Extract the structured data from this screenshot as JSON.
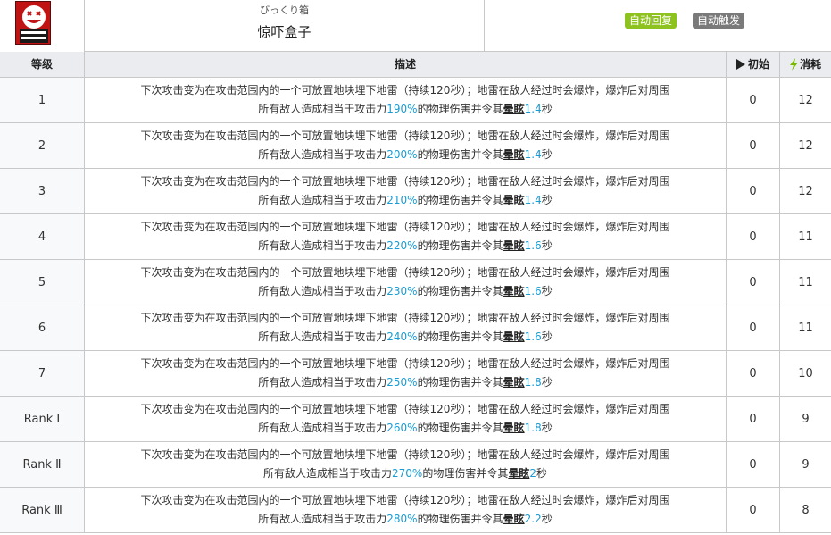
{
  "skill": {
    "ruby": "びっくり箱",
    "name": "惊吓盒子",
    "tags": [
      "自动回复",
      "自动触发"
    ],
    "icon": "surprise-box-skill-icon"
  },
  "table": {
    "headers": {
      "level": "等级",
      "desc": "描述",
      "init": "初始",
      "cost": "消耗"
    },
    "rows": [
      {
        "level": "1",
        "line1": "下次攻击变为在攻击范围内的一个可放置地块埋下地雷（持续120秒）；地雷在敌人经过时会爆炸，爆炸后对周围",
        "pre": "所有敌人造成相当于攻击力",
        "atk": "190%",
        "mid": "的物理伤害并令其",
        "kw": "晕眩",
        "dur": "1.4",
        "unit": "秒",
        "init": "0",
        "cost": "12"
      },
      {
        "level": "2",
        "line1": "下次攻击变为在攻击范围内的一个可放置地块埋下地雷（持续120秒）；地雷在敌人经过时会爆炸，爆炸后对周围",
        "pre": "所有敌人造成相当于攻击力",
        "atk": "200%",
        "mid": "的物理伤害并令其",
        "kw": "晕眩",
        "dur": "1.4",
        "unit": "秒",
        "init": "0",
        "cost": "12"
      },
      {
        "level": "3",
        "line1": "下次攻击变为在攻击范围内的一个可放置地块埋下地雷（持续120秒）；地雷在敌人经过时会爆炸，爆炸后对周围",
        "pre": "所有敌人造成相当于攻击力",
        "atk": "210%",
        "mid": "的物理伤害并令其",
        "kw": "晕眩",
        "dur": "1.4",
        "unit": "秒",
        "init": "0",
        "cost": "12"
      },
      {
        "level": "4",
        "line1": "下次攻击变为在攻击范围内的一个可放置地块埋下地雷（持续120秒）；地雷在敌人经过时会爆炸，爆炸后对周围",
        "pre": "所有敌人造成相当于攻击力",
        "atk": "220%",
        "mid": "的物理伤害并令其",
        "kw": "晕眩",
        "dur": "1.6",
        "unit": "秒",
        "init": "0",
        "cost": "11"
      },
      {
        "level": "5",
        "line1": "下次攻击变为在攻击范围内的一个可放置地块埋下地雷（持续120秒）；地雷在敌人经过时会爆炸，爆炸后对周围",
        "pre": "所有敌人造成相当于攻击力",
        "atk": "230%",
        "mid": "的物理伤害并令其",
        "kw": "晕眩",
        "dur": "1.6",
        "unit": "秒",
        "init": "0",
        "cost": "11"
      },
      {
        "level": "6",
        "line1": "下次攻击变为在攻击范围内的一个可放置地块埋下地雷（持续120秒）；地雷在敌人经过时会爆炸，爆炸后对周围",
        "pre": "所有敌人造成相当于攻击力",
        "atk": "240%",
        "mid": "的物理伤害并令其",
        "kw": "晕眩",
        "dur": "1.6",
        "unit": "秒",
        "init": "0",
        "cost": "11"
      },
      {
        "level": "7",
        "line1": "下次攻击变为在攻击范围内的一个可放置地块埋下地雷（持续120秒）；地雷在敌人经过时会爆炸，爆炸后对周围",
        "pre": "所有敌人造成相当于攻击力",
        "atk": "250%",
        "mid": "的物理伤害并令其",
        "kw": "晕眩",
        "dur": "1.8",
        "unit": "秒",
        "init": "0",
        "cost": "10"
      },
      {
        "level": "Rank Ⅰ",
        "line1": "下次攻击变为在攻击范围内的一个可放置地块埋下地雷（持续120秒）；地雷在敌人经过时会爆炸，爆炸后对周围",
        "pre": "所有敌人造成相当于攻击力",
        "atk": "260%",
        "mid": "的物理伤害并令其",
        "kw": "晕眩",
        "dur": "1.8",
        "unit": "秒",
        "init": "0",
        "cost": "9"
      },
      {
        "level": "Rank Ⅱ",
        "line1": "下次攻击变为在攻击范围内的一个可放置地块埋下地雷（持续120秒）；地雷在敌人经过时会爆炸，爆炸后对周围",
        "pre": "所有敌人造成相当于攻击力",
        "atk": "270%",
        "mid": "的物理伤害并令其",
        "kw": "晕眩",
        "dur": "2",
        "unit": "秒",
        "init": "0",
        "cost": "9"
      },
      {
        "level": "Rank Ⅲ",
        "line1": "下次攻击变为在攻击范围内的一个可放置地块埋下地雷（持续120秒）；地雷在敌人经过时会爆炸，爆炸后对周围",
        "pre": "所有敌人造成相当于攻击力",
        "atk": "280%",
        "mid": "的物理伤害并令其",
        "kw": "晕眩",
        "dur": "2.2",
        "unit": "秒",
        "init": "0",
        "cost": "8"
      }
    ]
  }
}
